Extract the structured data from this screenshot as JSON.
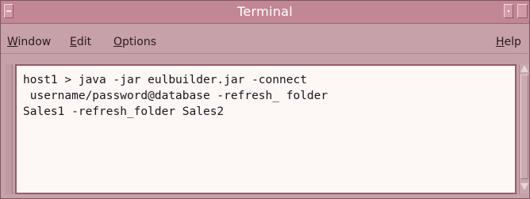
{
  "window": {
    "title": "Terminal"
  },
  "menubar": {
    "items": [
      {
        "label": "Window"
      },
      {
        "label": "Edit"
      },
      {
        "label": "Options"
      }
    ],
    "help_label": "Help"
  },
  "terminal": {
    "lines": [
      "host1 > java -jar eulbuilder.jar -connect",
      " username/password@database -refresh_ folder",
      "Sales1 -refresh_folder Sales2"
    ]
  },
  "icons": {
    "window_menu": "window-menu-icon",
    "minimize": "minimize-icon",
    "maximize": "maximize-icon",
    "scroll_up": "scroll-up-arrow-icon",
    "scroll_down": "scroll-down-arrow-icon"
  },
  "colors": {
    "titlebar": "#c28795",
    "window_bg": "#c6a1a9",
    "terminal_bg": "#fdf7f5",
    "text": "#1c1418"
  }
}
